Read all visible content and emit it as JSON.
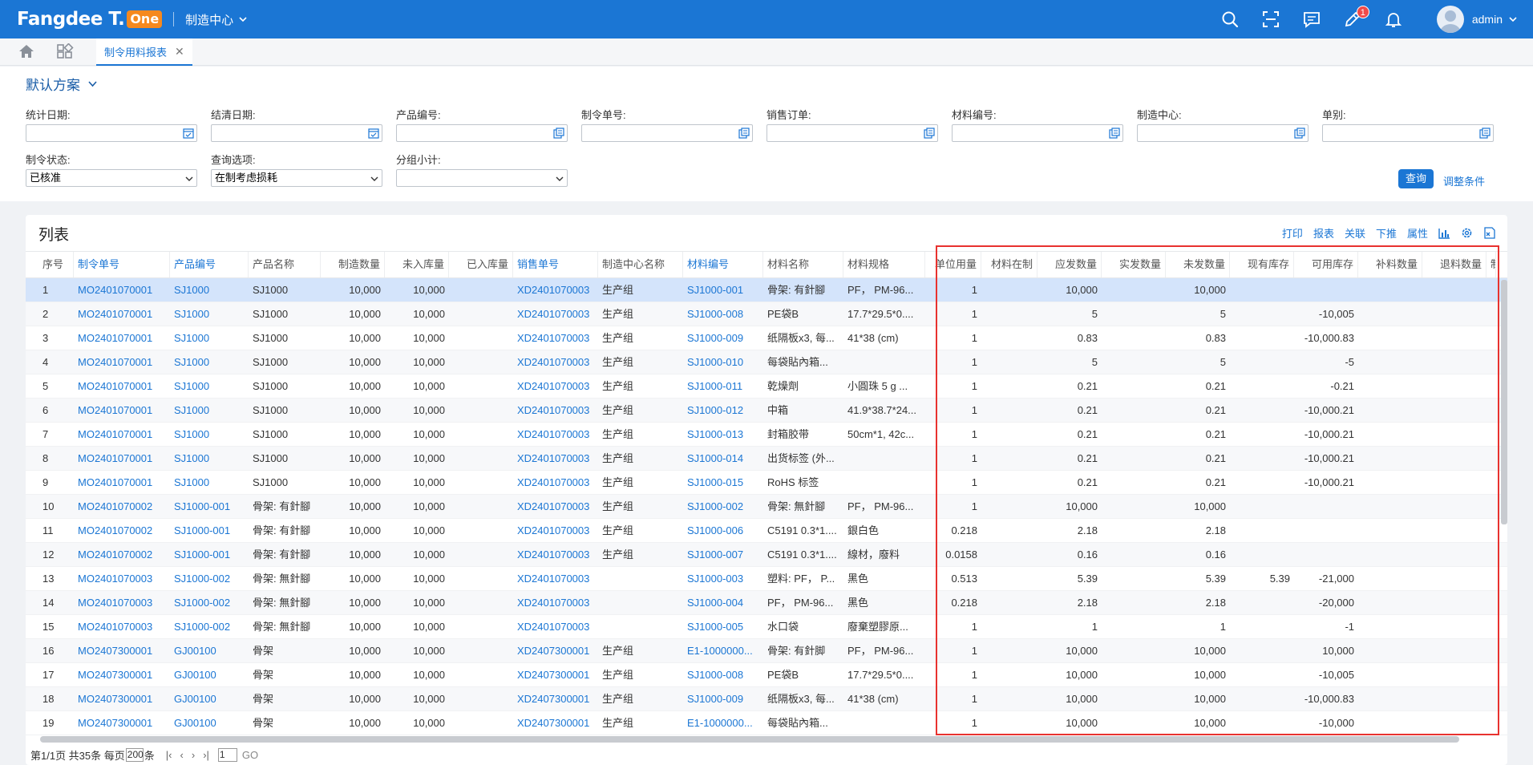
{
  "topbar": {
    "logo_text": "Fangdee T.",
    "logo_badge": "One",
    "center": "制造中心",
    "edit_badge": "1",
    "username": "admin"
  },
  "tabs": {
    "active": "制令用料报表"
  },
  "filter": {
    "scheme": "默认方案",
    "fields": [
      {
        "label": "统计日期:",
        "value": "",
        "icon": "calendar-icon"
      },
      {
        "label": "结清日期:",
        "value": "",
        "icon": "calendar-icon"
      },
      {
        "label": "产品编号:",
        "value": "",
        "icon": "lookup-icon"
      },
      {
        "label": "制令单号:",
        "value": "",
        "icon": "lookup-icon"
      },
      {
        "label": "销售订单:",
        "value": "",
        "icon": "lookup-icon"
      },
      {
        "label": "材料编号:",
        "value": "",
        "icon": "lookup-icon"
      },
      {
        "label": "制造中心:",
        "value": "",
        "icon": "lookup-icon"
      },
      {
        "label": "单别:",
        "value": "",
        "icon": "lookup-icon"
      },
      {
        "label": "制令状态:",
        "value": "已核准",
        "icon": "chevron-down-icon"
      },
      {
        "label": "查询选项:",
        "value": "在制考虑损耗",
        "icon": "chevron-down-icon"
      },
      {
        "label": "分组小计:",
        "value": "",
        "icon": "chevron-down-icon"
      }
    ],
    "query_label": "查询",
    "adjust_label": "调整条件"
  },
  "list": {
    "title": "列表",
    "tools": [
      "打印",
      "报表",
      "关联",
      "下推",
      "属性"
    ],
    "columns": [
      "序号",
      "制令单号",
      "产品编号",
      "产品名称",
      "制造数量",
      "未入库量",
      "已入库量",
      "销售单号",
      "制造中心名称",
      "材料编号",
      "材料名称",
      "材料规格",
      "单位用量",
      "材料在制",
      "应发数量",
      "实发数量",
      "未发数量",
      "现有库存",
      "可用库存",
      "补料数量",
      "退料数量",
      "制"
    ],
    "link_columns": [
      1,
      2,
      7,
      9
    ],
    "rows": [
      [
        "1",
        "MO2401070001",
        "SJ1000",
        "SJ1000",
        "10,000",
        "10,000",
        "",
        "XD2401070003",
        "生产组",
        "SJ1000-001",
        "骨架: 有針腳",
        "PF， PM-96...",
        "1",
        "",
        "10,000",
        "",
        "10,000",
        "",
        "",
        "",
        "",
        ""
      ],
      [
        "2",
        "MO2401070001",
        "SJ1000",
        "SJ1000",
        "10,000",
        "10,000",
        "",
        "XD2401070003",
        "生产组",
        "SJ1000-008",
        "PE袋B",
        "17.7*29.5*0....",
        "1",
        "",
        "5",
        "",
        "5",
        "",
        "-10,005",
        "",
        "",
        ""
      ],
      [
        "3",
        "MO2401070001",
        "SJ1000",
        "SJ1000",
        "10,000",
        "10,000",
        "",
        "XD2401070003",
        "生产组",
        "SJ1000-009",
        "纸隔板x3, 每...",
        "41*38 (cm)",
        "1",
        "",
        "0.83",
        "",
        "0.83",
        "",
        "-10,000.83",
        "",
        "",
        ""
      ],
      [
        "4",
        "MO2401070001",
        "SJ1000",
        "SJ1000",
        "10,000",
        "10,000",
        "",
        "XD2401070003",
        "生产组",
        "SJ1000-010",
        "每袋貼內箱...",
        "",
        "1",
        "",
        "5",
        "",
        "5",
        "",
        "-5",
        "",
        "",
        ""
      ],
      [
        "5",
        "MO2401070001",
        "SJ1000",
        "SJ1000",
        "10,000",
        "10,000",
        "",
        "XD2401070003",
        "生产组",
        "SJ1000-011",
        "乾燥劑",
        "小圓珠 5 g ...",
        "1",
        "",
        "0.21",
        "",
        "0.21",
        "",
        "-0.21",
        "",
        "",
        ""
      ],
      [
        "6",
        "MO2401070001",
        "SJ1000",
        "SJ1000",
        "10,000",
        "10,000",
        "",
        "XD2401070003",
        "生产组",
        "SJ1000-012",
        "中箱",
        "41.9*38.7*24...",
        "1",
        "",
        "0.21",
        "",
        "0.21",
        "",
        "-10,000.21",
        "",
        "",
        ""
      ],
      [
        "7",
        "MO2401070001",
        "SJ1000",
        "SJ1000",
        "10,000",
        "10,000",
        "",
        "XD2401070003",
        "生产组",
        "SJ1000-013",
        "封箱胶带",
        "50cm*1, 42c...",
        "1",
        "",
        "0.21",
        "",
        "0.21",
        "",
        "-10,000.21",
        "",
        "",
        ""
      ],
      [
        "8",
        "MO2401070001",
        "SJ1000",
        "SJ1000",
        "10,000",
        "10,000",
        "",
        "XD2401070003",
        "生产组",
        "SJ1000-014",
        "出货标签 (外...",
        "",
        "1",
        "",
        "0.21",
        "",
        "0.21",
        "",
        "-10,000.21",
        "",
        "",
        ""
      ],
      [
        "9",
        "MO2401070001",
        "SJ1000",
        "SJ1000",
        "10,000",
        "10,000",
        "",
        "XD2401070003",
        "生产组",
        "SJ1000-015",
        "RoHS 标签",
        "",
        "1",
        "",
        "0.21",
        "",
        "0.21",
        "",
        "-10,000.21",
        "",
        "",
        ""
      ],
      [
        "10",
        "MO2401070002",
        "SJ1000-001",
        "骨架: 有針腳",
        "10,000",
        "10,000",
        "",
        "XD2401070003",
        "生产组",
        "SJ1000-002",
        "骨架: 無針腳",
        "PF， PM-96...",
        "1",
        "",
        "10,000",
        "",
        "10,000",
        "",
        "",
        "",
        "",
        ""
      ],
      [
        "11",
        "MO2401070002",
        "SJ1000-001",
        "骨架: 有針腳",
        "10,000",
        "10,000",
        "",
        "XD2401070003",
        "生产组",
        "SJ1000-006",
        "C5191 0.3*1....",
        "銀白色",
        "0.218",
        "",
        "2.18",
        "",
        "2.18",
        "",
        "",
        "",
        "",
        ""
      ],
      [
        "12",
        "MO2401070002",
        "SJ1000-001",
        "骨架: 有針腳",
        "10,000",
        "10,000",
        "",
        "XD2401070003",
        "生产组",
        "SJ1000-007",
        "C5191 0.3*1....",
        "線材，廢料",
        "0.0158",
        "",
        "0.16",
        "",
        "0.16",
        "",
        "",
        "",
        "",
        ""
      ],
      [
        "13",
        "MO2401070003",
        "SJ1000-002",
        "骨架: 無針腳",
        "10,000",
        "10,000",
        "",
        "XD2401070003",
        "",
        "SJ1000-003",
        "塑料: PF， P...",
        "黑色",
        "0.513",
        "",
        "5.39",
        "",
        "5.39",
        "5.39",
        "-21,000",
        "",
        "",
        ""
      ],
      [
        "14",
        "MO2401070003",
        "SJ1000-002",
        "骨架: 無針腳",
        "10,000",
        "10,000",
        "",
        "XD2401070003",
        "",
        "SJ1000-004",
        "PF， PM-96...",
        "黑色",
        "0.218",
        "",
        "2.18",
        "",
        "2.18",
        "",
        "-20,000",
        "",
        "",
        ""
      ],
      [
        "15",
        "MO2401070003",
        "SJ1000-002",
        "骨架: 無針腳",
        "10,000",
        "10,000",
        "",
        "XD2401070003",
        "",
        "SJ1000-005",
        "水口袋",
        "廢棄塑膠原...",
        "1",
        "",
        "1",
        "",
        "1",
        "",
        "-1",
        "",
        "",
        ""
      ],
      [
        "16",
        "MO2407300001",
        "GJ00100",
        "骨架",
        "10,000",
        "10,000",
        "",
        "XD2407300001",
        "生产组",
        "E1-1000000...",
        "骨架: 有針脚",
        "PF， PM-96...",
        "1",
        "",
        "10,000",
        "",
        "10,000",
        "",
        "10,000",
        "",
        "",
        ""
      ],
      [
        "17",
        "MO2407300001",
        "GJ00100",
        "骨架",
        "10,000",
        "10,000",
        "",
        "XD2407300001",
        "生产组",
        "SJ1000-008",
        "PE袋B",
        "17.7*29.5*0....",
        "1",
        "",
        "10,000",
        "",
        "10,000",
        "",
        "-10,005",
        "",
        "",
        ""
      ],
      [
        "18",
        "MO2407300001",
        "GJ00100",
        "骨架",
        "10,000",
        "10,000",
        "",
        "XD2407300001",
        "生产组",
        "SJ1000-009",
        "纸隔板x3, 每...",
        "41*38 (cm)",
        "1",
        "",
        "10,000",
        "",
        "10,000",
        "",
        "-10,000.83",
        "",
        "",
        ""
      ],
      [
        "19",
        "MO2407300001",
        "GJ00100",
        "骨架",
        "10,000",
        "10,000",
        "",
        "XD2407300001",
        "生产组",
        "E1-1000000...",
        "每袋貼內箱...",
        "",
        "1",
        "",
        "10,000",
        "",
        "10,000",
        "",
        "-10,000",
        "",
        "",
        ""
      ]
    ],
    "selected_row": 0
  },
  "pager": {
    "page_info": "第1/1页 共35条 每页",
    "page_size": "200",
    "page_size_suffix": "条",
    "current_page": "1",
    "go_label": "GO"
  },
  "colors": {
    "brand": "#1b76d4",
    "highlight": "#e8322f",
    "logo_badge": "#f5891f"
  }
}
